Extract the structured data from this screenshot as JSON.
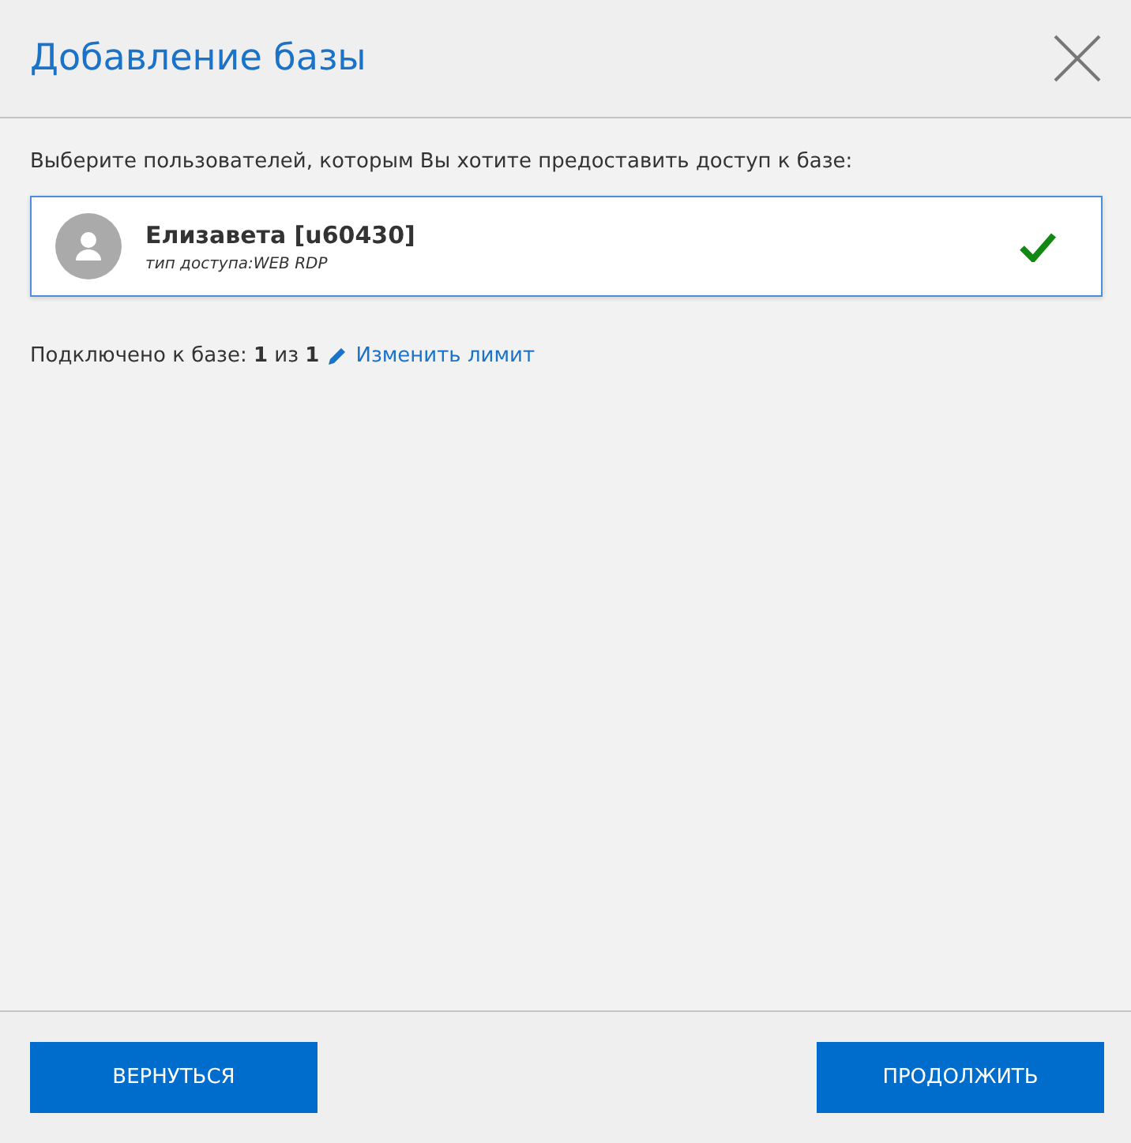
{
  "dialog": {
    "title": "Добавление базы"
  },
  "prompt": "Выберите пользователей, которым Вы хотите предоставить доступ к базе:",
  "users": [
    {
      "name": "Елизавета [u60430]",
      "access": "тип доступа:WEB RDP",
      "selected": true
    }
  ],
  "connected": {
    "text": "Подключено к базе: **1** из **1**",
    "link": "Изменить лимит"
  },
  "buttons": [
    {
      "label": "ВЕРНУТЬСЯ"
    },
    {
      "label": "ПРОДОЛЖИТЬ"
    }
  ]
}
